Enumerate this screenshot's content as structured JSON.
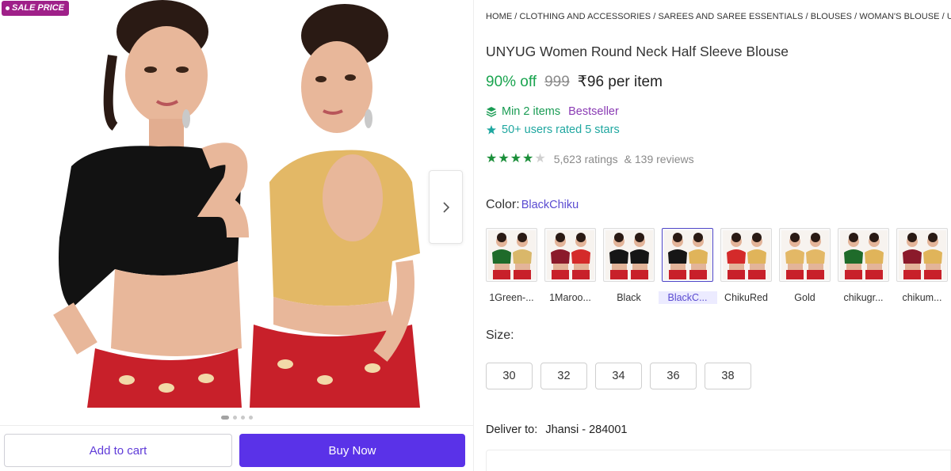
{
  "badge": {
    "sale_label": "SALE PRICE"
  },
  "gallery": {
    "slide_count": 4,
    "active_slide": 1
  },
  "actions": {
    "add_to_cart": "Add to cart",
    "buy_now": "Buy Now"
  },
  "breadcrumb": "HOME / CLOTHING AND ACCESSORIES / SAREES AND SAREE ESSENTIALS / BLOUSES / WOMAN'S BLOUSE / UNYUG WOMEN ROUND NECK HALF SLEEVE BLOUSE",
  "product": {
    "title": "UNYUG Women Round Neck Half Sleeve Blouse",
    "discount": "90% off",
    "mrp": "999",
    "price": "₹96 per item",
    "min_items": "Min 2 items",
    "bestseller": "Bestseller",
    "users_rated": "50+ users rated 5 stars",
    "rating_stars": 4,
    "ratings_text": "5,623 ratings",
    "reviews_text": "& 139 reviews"
  },
  "color": {
    "label": "Color:",
    "selected": "BlackChiku",
    "options": [
      {
        "name": "1Green-...",
        "icon": "green-blouse-thumbnail",
        "colors": [
          "#1f6b2a",
          "#d9b76a"
        ]
      },
      {
        "name": "1Maroo...",
        "icon": "maroon-red-blouse-thumbnail",
        "colors": [
          "#8b1a2b",
          "#d42a2a"
        ]
      },
      {
        "name": "Black",
        "icon": "black-blouse-thumbnail",
        "colors": [
          "#161616",
          "#161616"
        ]
      },
      {
        "name": "BlackC...",
        "icon": "black-chiku-blouse-thumbnail",
        "colors": [
          "#161616",
          "#e0b45a"
        ],
        "selected": true
      },
      {
        "name": "ChikuRed",
        "icon": "chiku-red-blouse-thumbnail",
        "colors": [
          "#d42a2a",
          "#e0b45a"
        ]
      },
      {
        "name": "Gold",
        "icon": "gold-blouse-thumbnail",
        "colors": [
          "#e3b866",
          "#e3b866"
        ]
      },
      {
        "name": "chikugr...",
        "icon": "chiku-green-blouse-thumbnail",
        "colors": [
          "#1f6b2a",
          "#e0b45a"
        ]
      },
      {
        "name": "chikum...",
        "icon": "chiku-maroon-blouse-thumbnail",
        "colors": [
          "#8b1a2b",
          "#e0b45a"
        ]
      }
    ]
  },
  "size": {
    "label": "Size:",
    "options": [
      "30",
      "32",
      "34",
      "36",
      "38"
    ]
  },
  "delivery": {
    "label": "Deliver to:",
    "location": "Jhansi - 284001"
  },
  "colors": {
    "brand_purple": "#5a32e8",
    "discount_green": "#1aa44f",
    "star_green": "#1b8f3a",
    "sale_badge": "#9f2089"
  }
}
